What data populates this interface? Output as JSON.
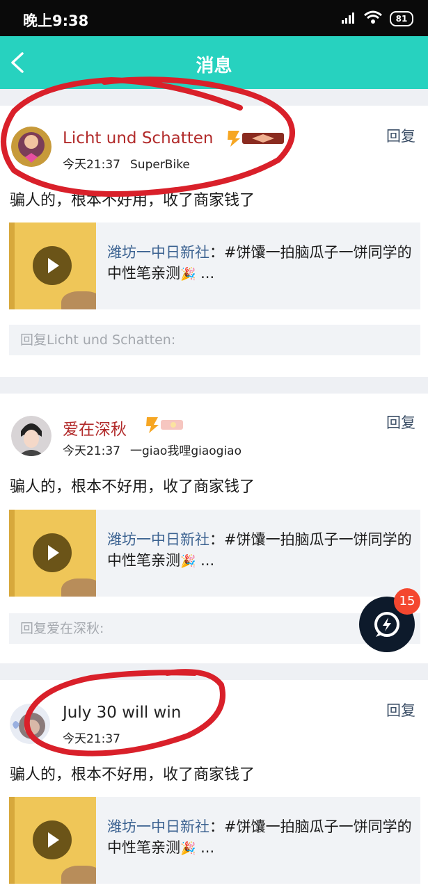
{
  "status_bar": {
    "time": "晚上9:38",
    "battery": "81"
  },
  "header": {
    "title": "消息"
  },
  "messages": [
    {
      "username": "Licht und Schatten",
      "time": "今天21:37",
      "subtitle": "SuperBike",
      "reply_label": "回复",
      "content": "骗人的，根本不好用，收了商家钱了",
      "ref_source": "潍坊一中日新社",
      "ref_text": "：#饼馕一拍脑瓜子一饼同学的中性笔亲测",
      "ref_ellipsis": " ...",
      "reply_placeholder": "回复Licht und Schatten:"
    },
    {
      "username": "爱在深秋",
      "time": "今天21:37",
      "subtitle": "一giao我哩giaogiao",
      "reply_label": "回复",
      "content": "骗人的，根本不好用，收了商家钱了",
      "ref_source": "潍坊一中日新社",
      "ref_text": "：#饼馕一拍脑瓜子一饼同学的中性笔亲测",
      "ref_ellipsis": " ...",
      "reply_placeholder": "回复爱在深秋:"
    },
    {
      "username": "July 30 will win",
      "time": "今天21:37",
      "reply_label": "回复",
      "content": "骗人的，根本不好用，收了商家钱了",
      "ref_source": "潍坊一中日新社",
      "ref_text": "：#饼馕一拍脑瓜子一饼同学的中性笔亲测",
      "ref_ellipsis": " ..."
    }
  ],
  "fab": {
    "badge_count": "15"
  },
  "colors": {
    "header": "#27d2bf",
    "username": "#b22b2b",
    "link": "#3a6190",
    "annotation": "#d9202a"
  }
}
